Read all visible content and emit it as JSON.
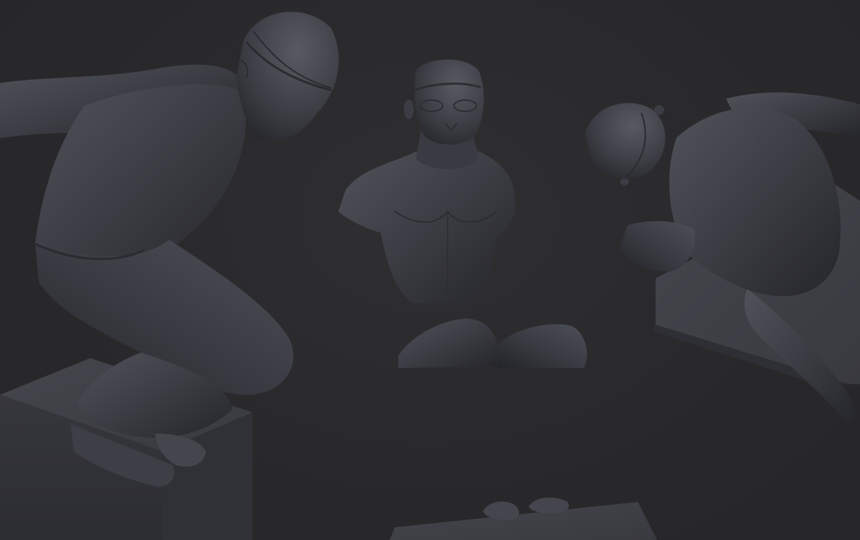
{
  "scene": {
    "background_color": "#2a2a2c",
    "material_color": "#3b3c42",
    "highlight_color": "#5a5c64",
    "shadow_color": "#1c1c1f",
    "figures": [
      {
        "name": "crouching-swimmer-side-view"
      },
      {
        "name": "swimmer-bust-front-view"
      },
      {
        "name": "knees-fragment"
      },
      {
        "name": "swimmer-top-view"
      },
      {
        "name": "hands-on-block-fragment"
      }
    ]
  }
}
